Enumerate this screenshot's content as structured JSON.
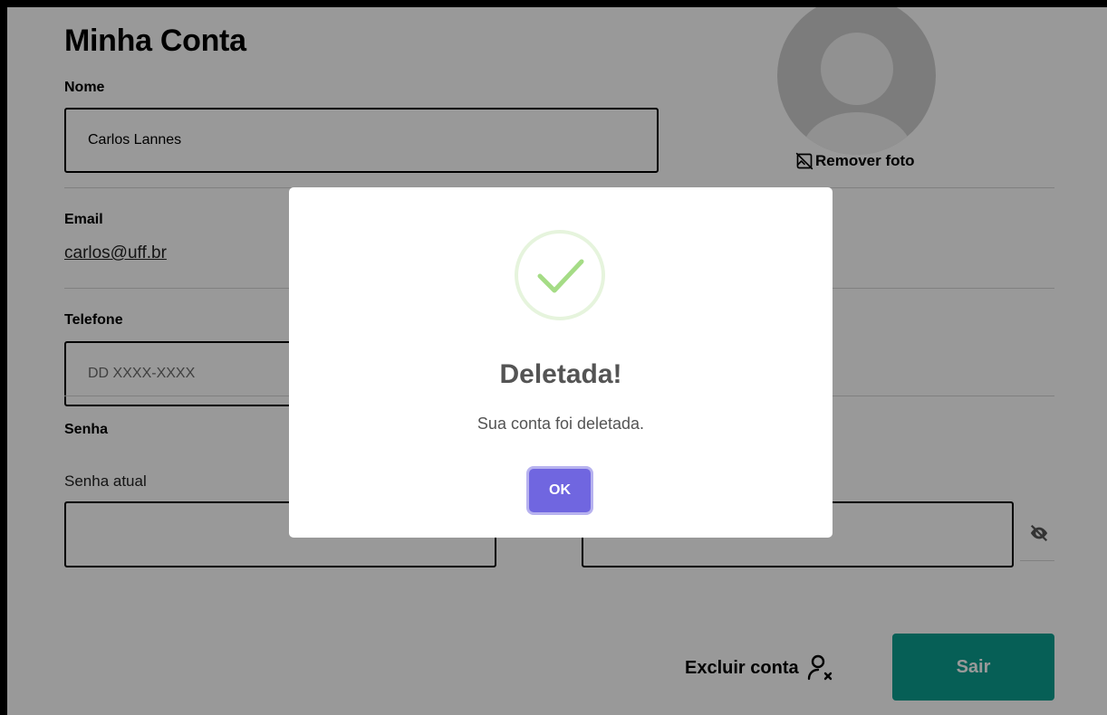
{
  "page": {
    "title": "Minha Conta",
    "name_label": "Nome",
    "name_value": "Carlos Lannes",
    "remove_photo_label": "Remover foto",
    "email_label": "Email",
    "email_value": "carlos@uff.br",
    "phone_label": "Telefone",
    "phone_placeholder": "DD XXXX-XXXX",
    "password_section_label": "Senha",
    "current_password_label": "Senha atual",
    "delete_account_label": "Excluir conta",
    "exit_button_label": "Sair"
  },
  "modal": {
    "icon": "success-check-icon",
    "title": "Deletada!",
    "text": "Sua conta foi deletada.",
    "ok_label": "OK"
  },
  "colors": {
    "overlay": "rgba(0,0,0,0.4)",
    "ok_button": "#7066e0",
    "exit_button": "#0a9e8f",
    "success": "#a5dc86"
  }
}
